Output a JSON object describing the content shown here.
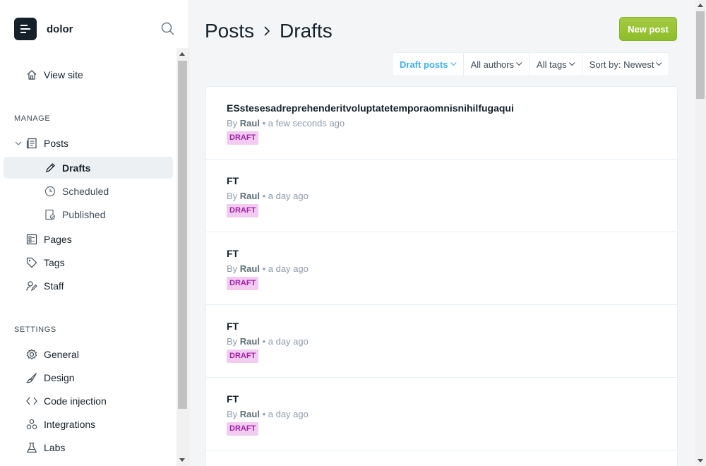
{
  "brand": {
    "name": "dolor"
  },
  "sidebar": {
    "view_site": "View site",
    "manage_heading": "MANAGE",
    "posts": "Posts",
    "drafts": "Drafts",
    "scheduled": "Scheduled",
    "published": "Published",
    "pages": "Pages",
    "tags": "Tags",
    "staff": "Staff",
    "settings_heading": "SETTINGS",
    "general": "General",
    "design": "Design",
    "code_injection": "Code injection",
    "integrations": "Integrations",
    "labs": "Labs"
  },
  "header": {
    "crumb_root": "Posts",
    "crumb_current": "Drafts",
    "new_post": "New post"
  },
  "filters": {
    "type": "Draft posts",
    "author": "All authors",
    "tag": "All tags",
    "sort": "Sort by: Newest"
  },
  "posts": [
    {
      "title": "ESstesesadreprehenderitvoluptatetemporaomnisnihilfugaqui",
      "by": "By",
      "author": "Raul",
      "time": "a few seconds ago",
      "status": "DRAFT"
    },
    {
      "title": "FT",
      "by": "By",
      "author": "Raul",
      "time": "a day ago",
      "status": "DRAFT"
    },
    {
      "title": "FT",
      "by": "By",
      "author": "Raul",
      "time": "a day ago",
      "status": "DRAFT"
    },
    {
      "title": "FT",
      "by": "By",
      "author": "Raul",
      "time": "a day ago",
      "status": "DRAFT"
    },
    {
      "title": "FT",
      "by": "By",
      "author": "Raul",
      "time": "a day ago",
      "status": "DRAFT"
    }
  ],
  "colors": {
    "accent": "#3eb0ef",
    "primary_button": "#9fca3f",
    "draft_badge_bg": "#f2ccf0",
    "draft_badge_text": "#a121a5"
  }
}
